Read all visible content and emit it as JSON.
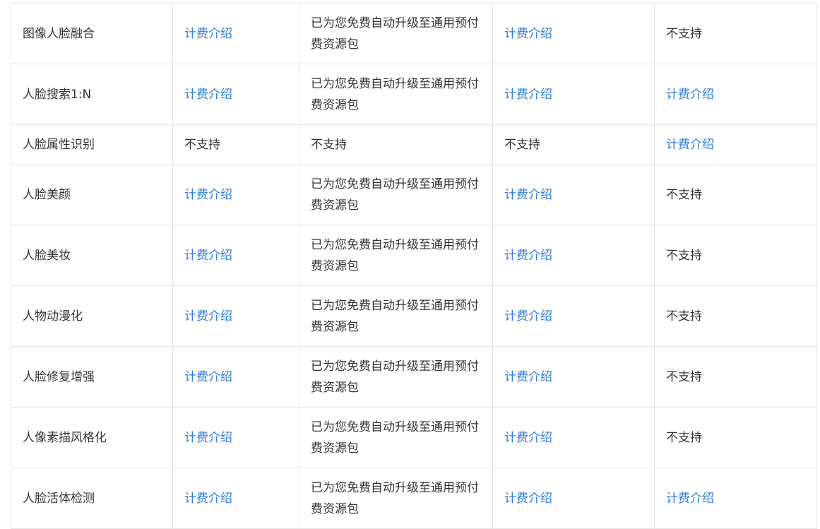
{
  "pricing_table": {
    "rows": [
      {
        "name": "图像人脸融合",
        "c2": "计费介绍",
        "c3": "已为您免费自动升级至通用预付费资源包",
        "c4": "计费介绍",
        "c5": "不支持"
      },
      {
        "name": "人脸搜索1:N",
        "c2": "计费介绍",
        "c3": "已为您免费自动升级至通用预付费资源包",
        "c4": "计费介绍",
        "c5": "计费介绍"
      },
      {
        "name": "人脸属性识别",
        "c2": "不支持",
        "c3": "不支持",
        "c4": "不支持",
        "c5": "计费介绍"
      },
      {
        "name": "人脸美颜",
        "c2": "计费介绍",
        "c3": "已为您免费自动升级至通用预付费资源包",
        "c4": "计费介绍",
        "c5": "不支持"
      },
      {
        "name": "人脸美妆",
        "c2": "计费介绍",
        "c3": "已为您免费自动升级至通用预付费资源包",
        "c4": "计费介绍",
        "c5": "不支持"
      },
      {
        "name": "人物动漫化",
        "c2": "计费介绍",
        "c3": "已为您免费自动升级至通用预付费资源包",
        "c4": "计费介绍",
        "c5": "不支持"
      },
      {
        "name": "人脸修复增强",
        "c2": "计费介绍",
        "c3": "已为您免费自动升级至通用预付费资源包",
        "c4": "计费介绍",
        "c5": "不支持"
      },
      {
        "name": "人像素描风格化",
        "c2": "计费介绍",
        "c3": "已为您免费自动升级至通用预付费资源包",
        "c4": "计费介绍",
        "c5": "不支持"
      },
      {
        "name": "人脸活体检测",
        "c2": "计费介绍",
        "c3": "已为您免费自动升级至通用预付费资源包",
        "c4": "计费介绍",
        "c5": "计费介绍"
      }
    ]
  },
  "colors": {
    "link": "#2f7ce0",
    "text": "#333333",
    "border": "#e5e5e5"
  }
}
